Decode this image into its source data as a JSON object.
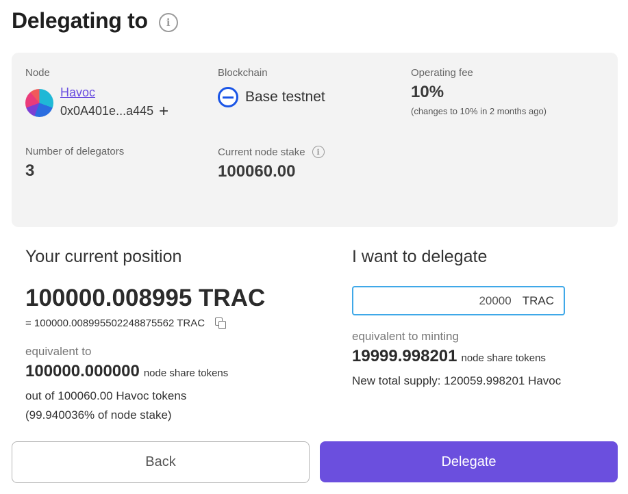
{
  "header": {
    "title": "Delegating to",
    "info_icon": "info-icon"
  },
  "node_card": {
    "node": {
      "label": "Node",
      "name": "Havoc",
      "address": "0x0A401e...a445",
      "add_symbol": "+"
    },
    "blockchain": {
      "label": "Blockchain",
      "name": "Base testnet",
      "icon": "base-chain-icon",
      "icon_color": "#1a55e6"
    },
    "operating_fee": {
      "label": "Operating fee",
      "value": "10%",
      "note": "(changes to 10% in 2 months ago)"
    },
    "delegators": {
      "label": "Number of delegators",
      "value": "3"
    },
    "node_stake": {
      "label": "Current node stake",
      "value": "100060.00",
      "info_icon": "info-icon"
    }
  },
  "position": {
    "title": "Your current position",
    "amount": "100000.008995 TRAC",
    "exact": "= 100000.008995502248875562 TRAC",
    "equivalent_label": "equivalent to",
    "share_tokens": "100000.000000",
    "share_tokens_unit": "node share tokens",
    "out_of": "out of 100060.00 Havoc tokens",
    "percent": "(99.940036% of node stake)"
  },
  "delegate": {
    "title": "I want to delegate",
    "input_value": "20000",
    "input_unit": "TRAC",
    "minting_label": "equivalent to minting",
    "minting_tokens": "19999.998201",
    "minting_unit": "node share tokens",
    "new_supply": "New total supply: 120059.998201 Havoc"
  },
  "buttons": {
    "back": "Back",
    "delegate": "Delegate"
  },
  "colors": {
    "accent": "#6b4fde",
    "input_border": "#3fa8e8",
    "link": "#6a4fe0",
    "card_bg": "#f3f3f3"
  }
}
